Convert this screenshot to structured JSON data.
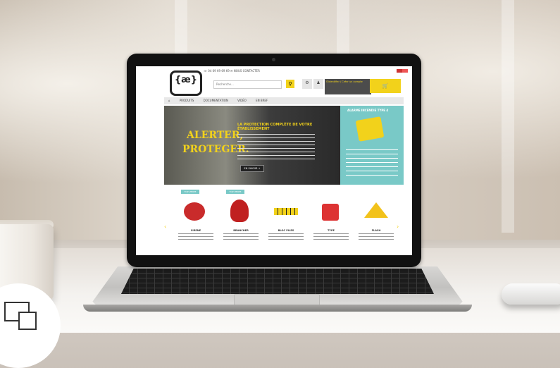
{
  "scene": {
    "description_objects": [
      "laptop",
      "coffee-cup",
      "mouse",
      "desk"
    ]
  },
  "site": {
    "phone": "☏ 04 69 69 69 69 ✉ NOUS CONTACTER",
    "search_placeholder": "Recherche...",
    "nav": [
      "PRODUITS",
      "DOCUMENTATION",
      "VIDÉO",
      "EN BREF"
    ],
    "hero_words": [
      "ALERTER,",
      "PROTEGER."
    ],
    "hero_title": "LA PROTECTION COMPLÈTE DE VOTRE ÉTABLISSEMENT",
    "hero_button": "EN SAVOIR +",
    "side_title": "ALARME INCENDIE TYPE 4",
    "account_label": "S'identifier / Créer un compte",
    "products": [
      {
        "tag": "TOP VENTE",
        "name": "SIRENE",
        "color": "#c92b2b"
      },
      {
        "tag": "TOP VENTE",
        "name": "BRANCHER",
        "color": "#c02020"
      },
      {
        "tag": "",
        "name": "BLOC PILES",
        "color": "#f2d21b"
      },
      {
        "tag": "",
        "name": "TYPE",
        "color": "#d33"
      },
      {
        "tag": "",
        "name": "FLASH",
        "color": "#f2c21b"
      }
    ]
  }
}
